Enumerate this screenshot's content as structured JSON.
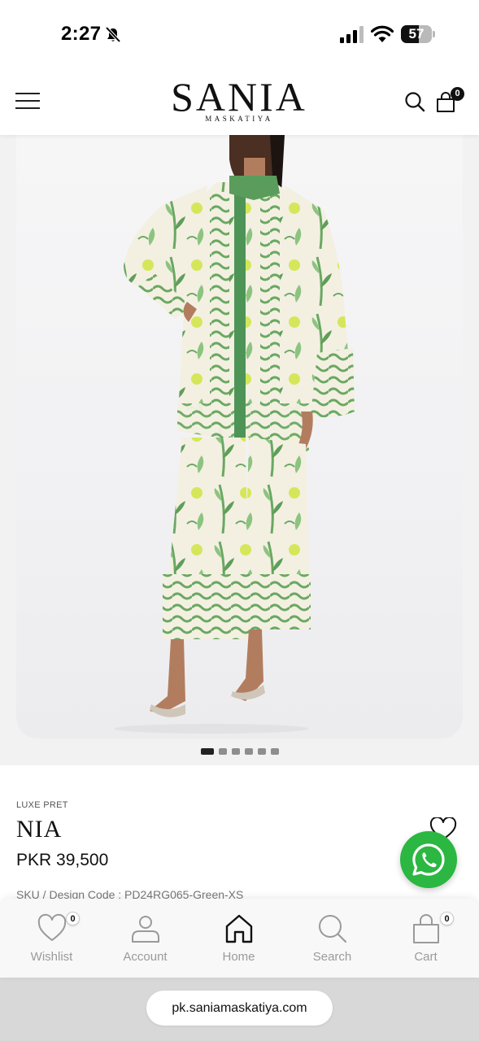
{
  "status_bar": {
    "time": "2:27",
    "battery_level": "57",
    "battery_fraction": 0.57,
    "icons": [
      "bell-slash-icon",
      "cellular-signal-icon",
      "wifi-icon",
      "battery-icon"
    ]
  },
  "header": {
    "brand_name": "SANIA",
    "brand_subtitle": "MASKATIYA",
    "cart_count": "0",
    "icons": [
      "hamburger-menu-icon",
      "search-icon",
      "shopping-bag-icon"
    ]
  },
  "gallery": {
    "image_count": 6,
    "active_index": 0,
    "colors": {
      "print_green": "#5f9e58",
      "print_light_green": "#8cc47f",
      "fabric_cream": "#f3f0e2",
      "accent_yellow": "#d6e65a"
    }
  },
  "product": {
    "category": "LUXE PRET",
    "name": "NIA",
    "price": "PKR 39,500",
    "sku": "SKU / Design Code : PD24RG065-Green-XS"
  },
  "bottom_nav": {
    "items": [
      {
        "label": "Wishlist",
        "icon": "heart-icon",
        "badge": "0"
      },
      {
        "label": "Account",
        "icon": "user-icon",
        "badge": ""
      },
      {
        "label": "Home",
        "icon": "home-icon",
        "badge": ""
      },
      {
        "label": "Search",
        "icon": "search-icon",
        "badge": ""
      },
      {
        "label": "Cart",
        "icon": "shopping-bag-icon",
        "badge": "0"
      }
    ]
  },
  "browser": {
    "url": "pk.saniamaskatiya.com"
  },
  "colors": {
    "whatsapp_green": "#2bb741",
    "text_dark": "#111111",
    "nav_label": "#9a9a9a"
  }
}
